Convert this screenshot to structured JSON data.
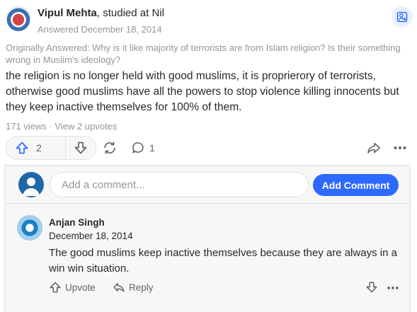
{
  "answer": {
    "author_name": "Vipul Mehta",
    "author_credential": ", studied at Nil",
    "answered_date": "Answered December 18, 2014",
    "originally_answered": "Originally Answered: Why is it like majority of terrorists are from Islam religion? Is their something wrong in Muslim's ideology?",
    "text": "the religion is no longer held with good muslims, it is proprierory of terrorists, otherwise good muslims have all the powers to stop violence killing innocents but they keep inactive themselves for 100% of them.",
    "stats": "171 views · View 2 upvotes",
    "upvote_count": "2",
    "comment_count": "1"
  },
  "comment_input": {
    "placeholder": "Add a comment...",
    "button_label": "Add Comment"
  },
  "comments": [
    {
      "name": "Anjan Singh",
      "date": "December 18, 2014",
      "text": "The good muslims keep inactive themselves because they are always in a win win situation.",
      "upvote_label": "Upvote",
      "reply_label": "Reply"
    }
  ],
  "colors": {
    "accent": "#2e69ff",
    "text": "#282829",
    "muted": "#939598",
    "border": "#dee0e1",
    "panel": "#f7f7f8"
  }
}
